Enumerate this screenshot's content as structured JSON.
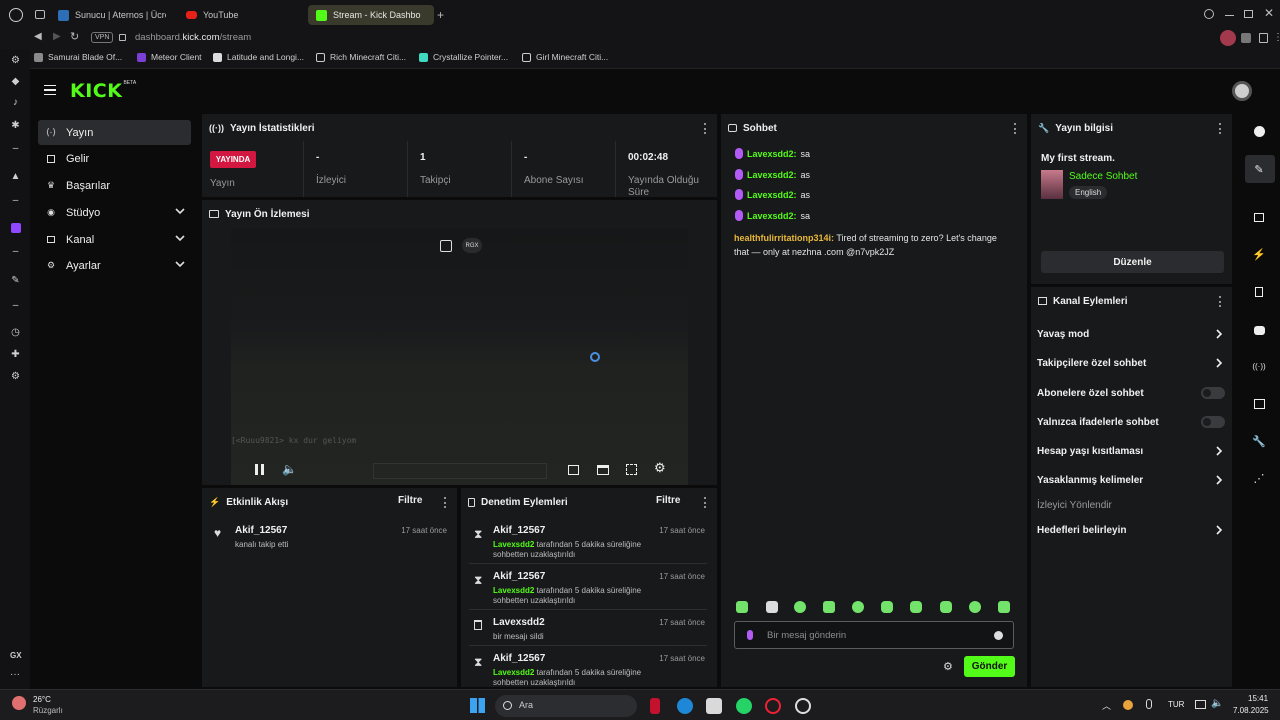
{
  "browser": {
    "tabs": [
      {
        "label": "Sunucu | Aternos | Ücreta",
        "active": false
      },
      {
        "label": "YouTube",
        "active": false
      },
      {
        "label": "Stream - Kick Dashbo",
        "active": true
      }
    ],
    "vpn_label": "VPN",
    "url_prefix": "dashboard.",
    "url_host": "kick.com",
    "url_path": "/stream",
    "bookmarks": [
      "Samurai Blade Of...",
      "Meteor Client",
      "Latitude and Longi...",
      "Rich Minecraft Citi...",
      "Crystallize Pointer...",
      "Girl Minecraft Citi..."
    ],
    "sidebar_label": "GX"
  },
  "kick": {
    "logo": "KICK",
    "logo_sup": "BETA"
  },
  "nav": {
    "items": [
      {
        "label": "Yayın",
        "icon": "stream-icon",
        "expandable": false,
        "selected": true
      },
      {
        "label": "Gelir",
        "icon": "revenue-icon",
        "expandable": false,
        "selected": false
      },
      {
        "label": "Başarılar",
        "icon": "trophy-icon",
        "expandable": false,
        "selected": false
      },
      {
        "label": "Stüdyo",
        "icon": "studio-icon",
        "expandable": true,
        "selected": false
      },
      {
        "label": "Kanal",
        "icon": "channel-icon",
        "expandable": true,
        "selected": false
      },
      {
        "label": "Ayarlar",
        "icon": "settings-icon",
        "expandable": true,
        "selected": false
      }
    ]
  },
  "stats": {
    "title": "Yayın İstatistikleri",
    "live_badge": "YAYINDA",
    "live_label": "Yayın",
    "items": [
      {
        "value": "-",
        "label": "İzleyici"
      },
      {
        "value": "1",
        "label": "Takipçi"
      },
      {
        "value": "-",
        "label": "Abone Sayısı"
      },
      {
        "value": "00:02:48",
        "label": "Yayında Olduğu Süre"
      }
    ]
  },
  "preview": {
    "title": "Yayın Ön İzlemesi",
    "badge": "RGX",
    "game_chat": "[<Ruuu9821> kx dur geliyom"
  },
  "activity": {
    "title": "Etkinlik Akışı",
    "filter": "Filtre",
    "items": [
      {
        "user": "Akif_12567",
        "text": "kanalı takip etti",
        "time": "17 saat önce"
      }
    ]
  },
  "moderation": {
    "title": "Denetim Eylemleri",
    "filter": "Filtre",
    "items": [
      {
        "user": "Akif_12567",
        "actor": "Lavexsdd2",
        "text": "tarafından 5 dakika süreliğine sohbetten uzaklaştırıldı",
        "time": "17 saat önce",
        "icon": "hourglass-icon"
      },
      {
        "user": "Akif_12567",
        "actor": "Lavexsdd2",
        "text": "tarafından 5 dakika süreliğine sohbetten uzaklaştırıldı",
        "time": "17 saat önce",
        "icon": "hourglass-icon"
      },
      {
        "user": "Lavexsdd2",
        "actor": "",
        "text": "bir mesajı sildi",
        "time": "17 saat önce",
        "icon": "trash-icon"
      },
      {
        "user": "Akif_12567",
        "actor": "Lavexsdd2",
        "text": "tarafından 5 dakika süreliğine sohbetten uzaklaştırıldı",
        "time": "17 saat önce",
        "icon": "hourglass-icon"
      }
    ]
  },
  "chat": {
    "title": "Sohbet",
    "messages": [
      {
        "user": "Lavexsdd2:",
        "text": "sa"
      },
      {
        "user": "Lavexsdd2:",
        "text": "as"
      },
      {
        "user": "Lavexsdd2:",
        "text": "as"
      },
      {
        "user": "Lavexsdd2:",
        "text": "sa"
      }
    ],
    "spam_user": "healthfulirritationp314i:",
    "spam_text_1": "Tired of streaming to zero? Let's change",
    "spam_text_2": "that — only at nezhna .com @n7vpk2JZ",
    "input_placeholder": "Bir mesaj gönderin",
    "send_label": "Gönder",
    "accent": "#53fc18"
  },
  "info": {
    "title": "Yayın bilgisi",
    "stream_title": "My first stream.",
    "category": "Sadece Sohbet",
    "language": "English",
    "edit_label": "Düzenle"
  },
  "channel_actions": {
    "title": "Kanal Eylemleri",
    "items": [
      {
        "label": "Yavaş mod",
        "control": "arrow"
      },
      {
        "label": "Takipçilere özel sohbet",
        "control": "arrow"
      },
      {
        "label": "Abonelere özel sohbet",
        "control": "toggle"
      },
      {
        "label": "Yalnızca ifadelerle sohbet",
        "control": "toggle"
      },
      {
        "label": "Hesap yaşı kısıtlaması",
        "control": "arrow"
      },
      {
        "label": "Yasaklanmış kelimeler",
        "control": "arrow"
      },
      {
        "label": "İzleyici Yönlendir",
        "control": "none"
      },
      {
        "label": "Hedefleri belirleyin",
        "control": "arrow"
      }
    ]
  },
  "taskbar": {
    "weather_temp": "26°C",
    "weather_label": "Rüzgarlı",
    "search_label": "Ara",
    "lang": "TUR",
    "time": "15:41",
    "date": "7.08.2025"
  }
}
